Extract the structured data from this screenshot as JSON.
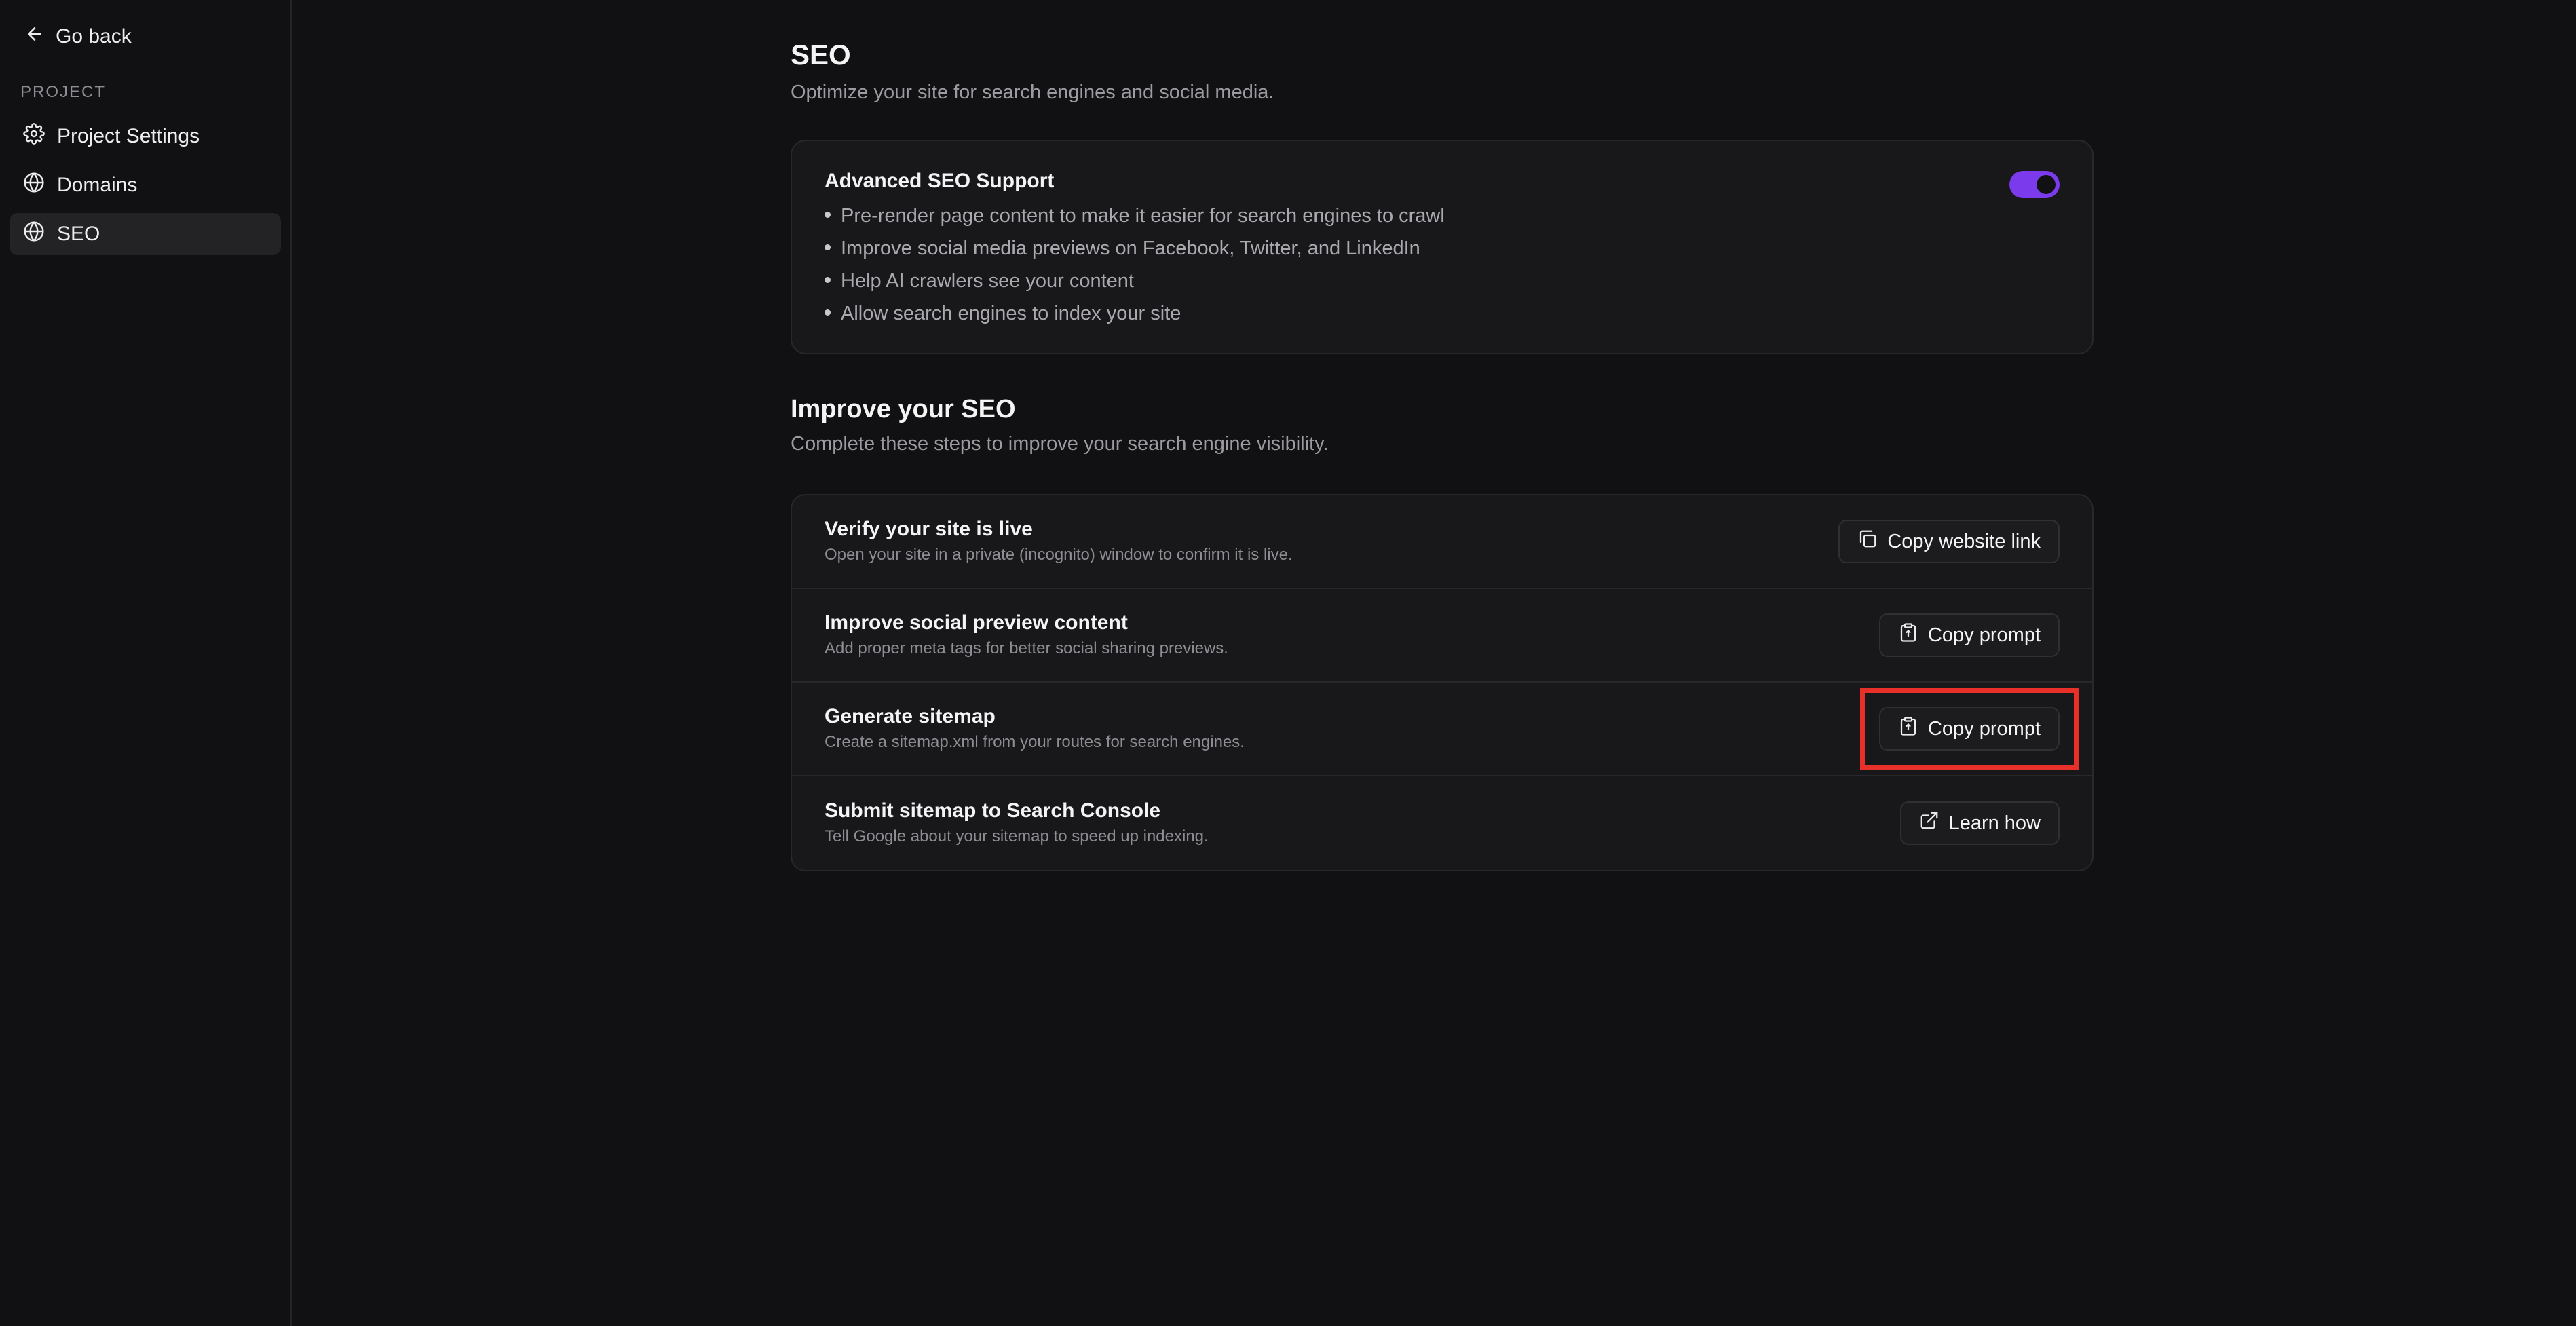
{
  "sidebar": {
    "back_label": "Go back",
    "section_label": "PROJECT",
    "items": [
      {
        "label": "Project Settings",
        "icon": "gear-icon"
      },
      {
        "label": "Domains",
        "icon": "globe-icon"
      },
      {
        "label": "SEO",
        "icon": "globe-icon",
        "active": true
      }
    ]
  },
  "header": {
    "title": "SEO",
    "subtitle": "Optimize your site for search engines and social media."
  },
  "advanced": {
    "title": "Advanced SEO Support",
    "enabled": true,
    "bullets": [
      "Pre-render page content to make it easier for search engines to crawl",
      "Improve social media previews on Facebook, Twitter, and LinkedIn",
      "Help AI crawlers see your content",
      "Allow search engines to index your site"
    ]
  },
  "improve": {
    "title": "Improve your SEO",
    "subtitle": "Complete these steps to improve your search engine visibility.",
    "steps": [
      {
        "title": "Verify your site is live",
        "desc": "Open your site in a private (incognito) window to confirm it is live.",
        "button": "Copy website link",
        "icon": "copy-icon"
      },
      {
        "title": "Improve social preview content",
        "desc": "Add proper meta tags for better social sharing previews.",
        "button": "Copy prompt",
        "icon": "clipboard-icon"
      },
      {
        "title": "Generate sitemap",
        "desc": "Create a sitemap.xml from your routes for search engines.",
        "button": "Copy prompt",
        "icon": "clipboard-icon",
        "highlighted": true
      },
      {
        "title": "Submit sitemap to Search Console",
        "desc": "Tell Google about your sitemap to speed up indexing.",
        "button": "Learn how",
        "icon": "external-link-icon"
      }
    ]
  },
  "colors": {
    "background": "#111113",
    "accent": "#7c3aed",
    "highlight": "#e8302a"
  }
}
